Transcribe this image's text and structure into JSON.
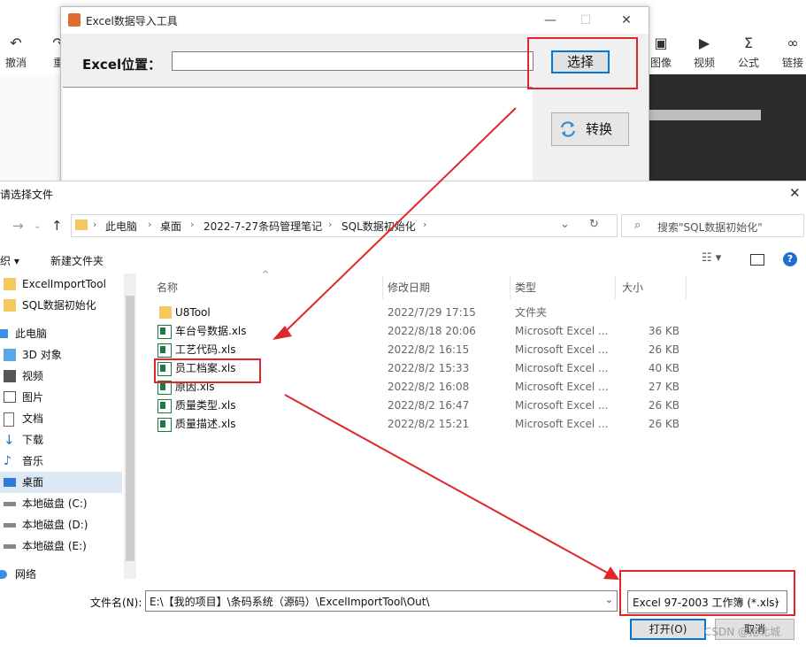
{
  "background_app": {
    "toolbar_items": [
      {
        "label": "撤消",
        "icon": "undo-icon"
      },
      {
        "label": "重",
        "icon": "redo-icon"
      },
      {
        "label": "图像",
        "icon": "image-icon"
      },
      {
        "label": "视频",
        "icon": "video-icon"
      },
      {
        "label": "公式",
        "icon": "sigma-icon"
      },
      {
        "label": "链接",
        "icon": "link-icon"
      }
    ]
  },
  "tool_window": {
    "title": "Excel数据导入工具",
    "excel_label": "Excel位置：",
    "path_value": "",
    "choose_button": "选择",
    "convert_button": "转换",
    "minimize": "—",
    "maximize": "☐",
    "close": "✕"
  },
  "dialog": {
    "title": "请选择文件",
    "close": "✕",
    "breadcrumb": [
      "此电脑",
      "桌面",
      "2022-7-27条码管理笔记",
      "SQL数据初始化"
    ],
    "search_placeholder": "搜索\"SQL数据初始化\"",
    "toolbar": {
      "organize": "织 ▾",
      "new_folder": "新建文件夹"
    },
    "sidebar": [
      {
        "label": "ExcelImportTool",
        "icon": "folder-icon"
      },
      {
        "label": "SQL数据初始化",
        "icon": "folder-icon"
      },
      {
        "label": "此电脑",
        "icon": "computer-icon"
      },
      {
        "label": "3D 对象",
        "icon": "cube-icon"
      },
      {
        "label": "视频",
        "icon": "video-icon"
      },
      {
        "label": "图片",
        "icon": "picture-icon"
      },
      {
        "label": "文档",
        "icon": "document-icon"
      },
      {
        "label": "下载",
        "icon": "download-icon"
      },
      {
        "label": "音乐",
        "icon": "music-icon"
      },
      {
        "label": "桌面",
        "icon": "desktop-icon"
      },
      {
        "label": "本地磁盘 (C:)",
        "icon": "drive-icon"
      },
      {
        "label": "本地磁盘 (D:)",
        "icon": "drive-icon"
      },
      {
        "label": "本地磁盘 (E:)",
        "icon": "drive-icon"
      },
      {
        "label": "网络",
        "icon": "network-icon"
      }
    ],
    "columns": {
      "name": "名称",
      "date": "修改日期",
      "type": "类型",
      "size": "大小"
    },
    "files": [
      {
        "name": "U8Tool",
        "date": "2022/7/29 17:15",
        "type": "文件夹",
        "size": "",
        "kind": "folder"
      },
      {
        "name": "车台号数据.xls",
        "date": "2022/8/18 20:06",
        "type": "Microsoft Excel ...",
        "size": "36 KB",
        "kind": "xls"
      },
      {
        "name": "工艺代码.xls",
        "date": "2022/8/2 16:15",
        "type": "Microsoft Excel ...",
        "size": "26 KB",
        "kind": "xls"
      },
      {
        "name": "员工档案.xls",
        "date": "2022/8/2 15:33",
        "type": "Microsoft Excel ...",
        "size": "40 KB",
        "kind": "xls"
      },
      {
        "name": "原因.xls",
        "date": "2022/8/2 16:08",
        "type": "Microsoft Excel ...",
        "size": "27 KB",
        "kind": "xls"
      },
      {
        "name": "质量类型.xls",
        "date": "2022/8/2 16:47",
        "type": "Microsoft Excel ...",
        "size": "26 KB",
        "kind": "xls"
      },
      {
        "name": "质量描述.xls",
        "date": "2022/8/2 15:21",
        "type": "Microsoft Excel ...",
        "size": "26 KB",
        "kind": "xls"
      }
    ],
    "filename_label": "文件名(N):",
    "filename_value": "E:\\【我的项目】\\条码系统（源码）\\ExcelImportTool\\Out\\",
    "filetype_value": "Excel 97-2003 工作簿 (*.xls)",
    "open_button": "打开(O)",
    "cancel_button": "取消"
  },
  "watermark": "CSDN @抢北城",
  "annotation_color": "#e0262b"
}
